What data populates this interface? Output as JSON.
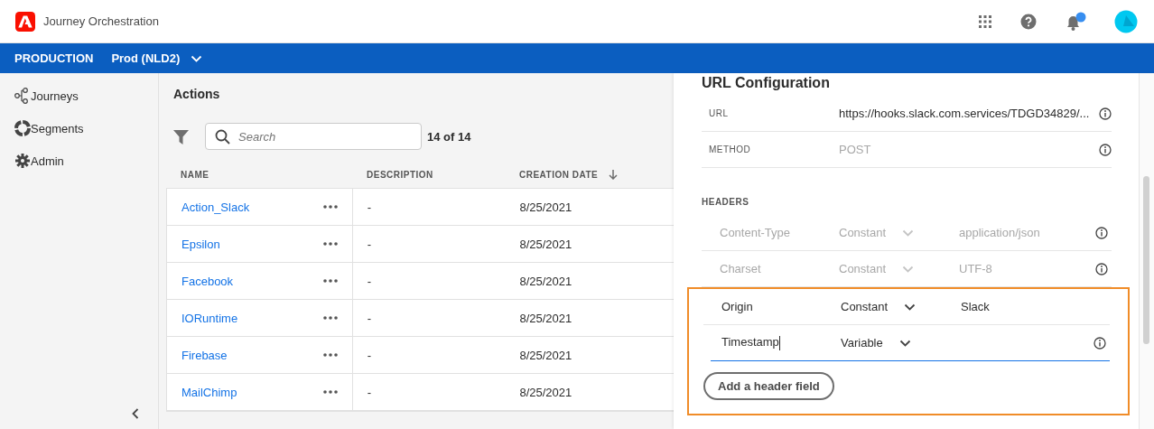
{
  "app": {
    "title": "Journey Orchestration"
  },
  "env_bar": {
    "label": "PRODUCTION",
    "sandbox": "Prod (NLD2)"
  },
  "sidebar": {
    "items": [
      {
        "label": "Journeys",
        "kind": "journeys"
      },
      {
        "label": "Segments",
        "kind": "segments"
      },
      {
        "label": "Admin",
        "kind": "admin"
      }
    ]
  },
  "actions": {
    "title": "Actions",
    "search": {
      "placeholder": "Search"
    },
    "count": "14 of 14",
    "table": {
      "columns": [
        {
          "label": "NAME",
          "sorted": false
        },
        {
          "label": "DESCRIPTION",
          "sorted": false
        },
        {
          "label": "CREATION DATE",
          "sorted": true
        }
      ],
      "rows": [
        {
          "name": "Action_Slack",
          "description": "-",
          "creation_date": "8/25/2021"
        },
        {
          "name": "Epsilon",
          "description": "-",
          "creation_date": "8/25/2021"
        },
        {
          "name": "Facebook",
          "description": "-",
          "creation_date": "8/25/2021"
        },
        {
          "name": "IORuntime",
          "description": "-",
          "creation_date": "8/25/2021"
        },
        {
          "name": "Firebase",
          "description": "-",
          "creation_date": "8/25/2021"
        },
        {
          "name": "MailChimp",
          "description": "-",
          "creation_date": "8/25/2021"
        }
      ]
    }
  },
  "url_configuration": {
    "title": "URL Configuration",
    "fields": [
      {
        "label": "URL",
        "value": "https://hooks.slack.com.services/TDGD34829/...",
        "disabled": false
      },
      {
        "label": "METHOD",
        "value": "POST",
        "disabled": true
      }
    ],
    "headers_label": "HEADERS",
    "headers": [
      {
        "name": "Content-Type",
        "type": "Constant",
        "value": "application/json",
        "disabled": true,
        "info": true,
        "focused": false
      },
      {
        "name": "Charset",
        "type": "Constant",
        "value": "UTF-8",
        "disabled": true,
        "info": true,
        "focused": false
      }
    ],
    "custom_headers": {
      "highlighted": true,
      "rows": [
        {
          "name": "Origin",
          "type": "Constant",
          "value": "Slack",
          "disabled": false,
          "info": false,
          "focused": false
        },
        {
          "name": "Timestamp",
          "type": "Variable",
          "disabled": false,
          "info": true,
          "focused": true
        }
      ],
      "add_button": "Add a header field"
    }
  }
}
